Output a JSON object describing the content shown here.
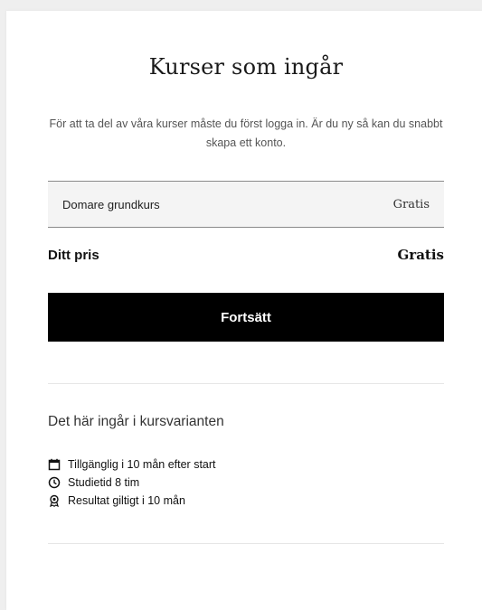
{
  "heading": "Kurser som ingår",
  "intro": "För att ta del av våra kurser måste du först logga in. Är du ny så kan du snabbt skapa ett konto.",
  "course": {
    "name": "Domare grundkurs",
    "price": "Gratis"
  },
  "total": {
    "label": "Ditt pris",
    "value": "Gratis"
  },
  "continue_label": "Fortsätt",
  "includes": {
    "heading": "Det här ingår i kursvarianten",
    "items": [
      {
        "icon": "calendar-icon",
        "text": "Tillgänglig i 10 mån efter start"
      },
      {
        "icon": "clock-icon",
        "text": "Studietid 8 tim"
      },
      {
        "icon": "award-icon",
        "text": "Resultat giltigt i 10 mån"
      }
    ]
  }
}
